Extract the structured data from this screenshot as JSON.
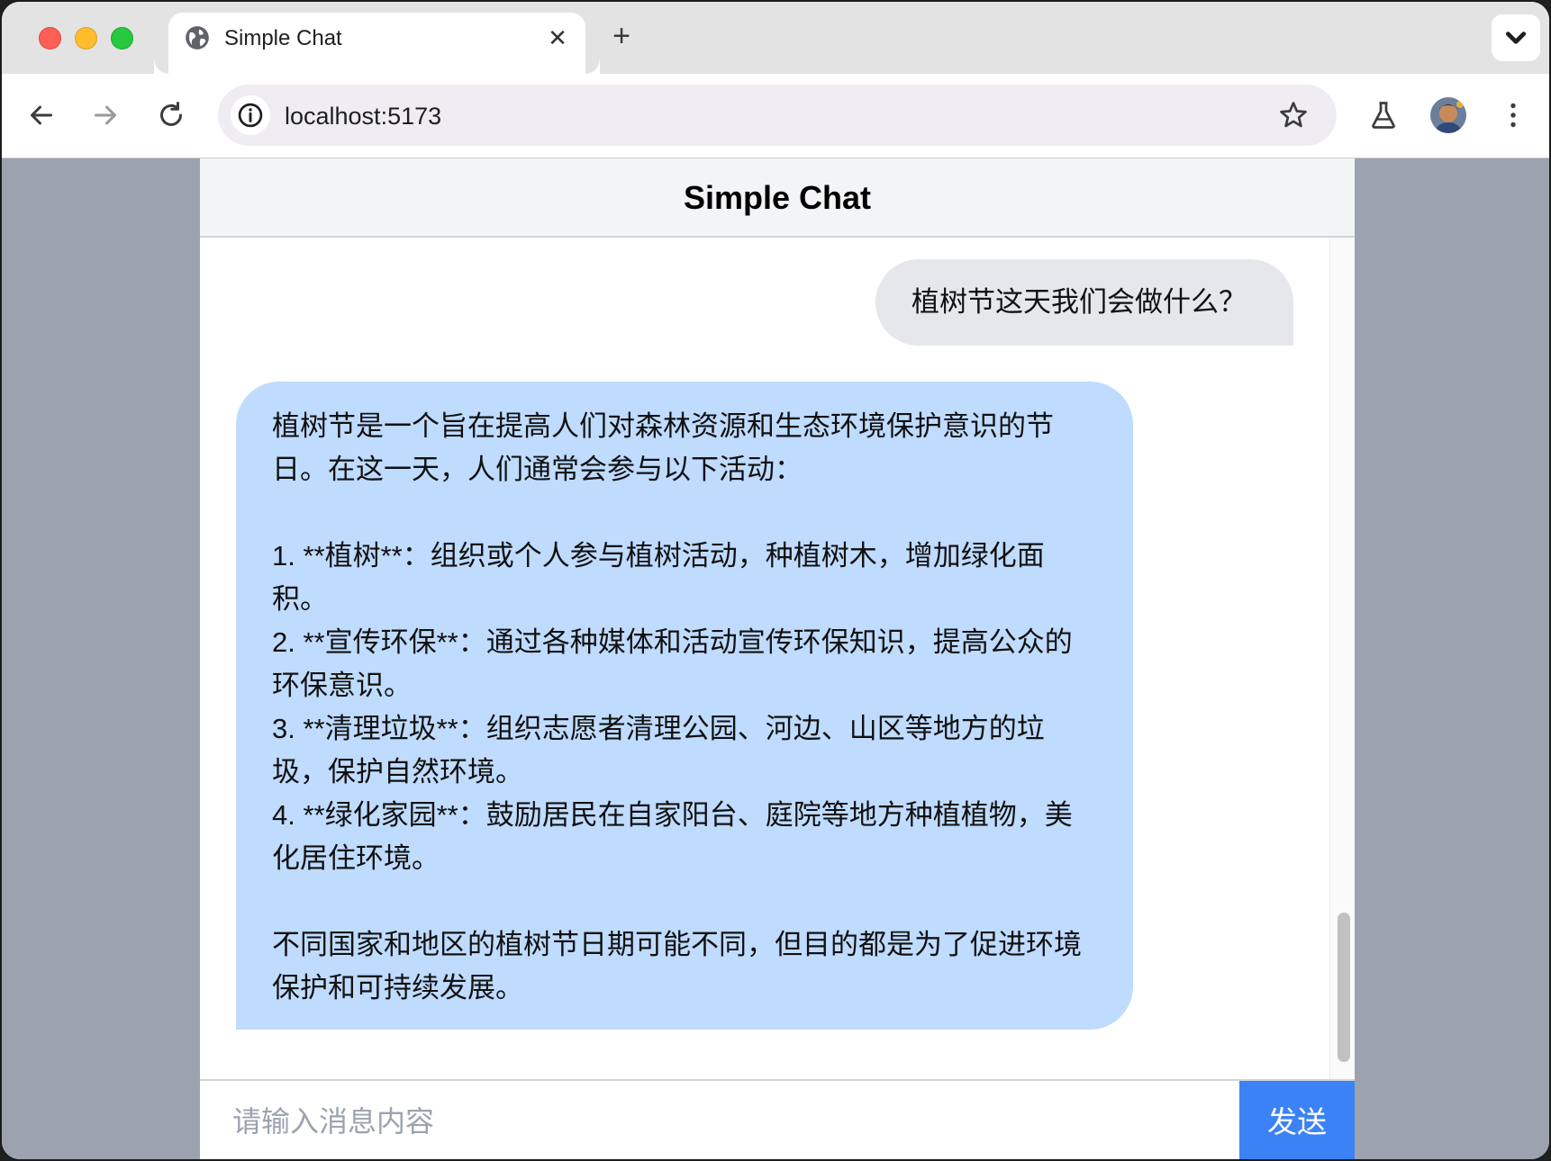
{
  "browser": {
    "tab_title": "Simple Chat",
    "tab_close": "✕",
    "new_tab": "+",
    "url": "localhost:5173"
  },
  "chat": {
    "title": "Simple Chat",
    "messages": [
      {
        "role": "user",
        "text": "植树节这天我们会做什么？"
      },
      {
        "role": "assistant",
        "text": "植树节是一个旨在提高人们对森林资源和生态环境保护意识的节日。在这一天，人们通常会参与以下活动：\n\n1. **植树**：组织或个人参与植树活动，种植树木，增加绿化面积。\n2. **宣传环保**：通过各种媒体和活动宣传环保知识，提高公众的环保意识。\n3. **清理垃圾**：组织志愿者清理公园、河边、山区等地方的垃圾，保护自然环境。\n4. **绿化家园**：鼓励居民在自家阳台、庭院等地方种植植物，美化居住环境。\n\n不同国家和地区的植树节日期可能不同，但目的都是为了促进环境保护和可持续发展。"
      }
    ],
    "input_placeholder": "请输入消息内容",
    "input_value": "",
    "send_label": "发送"
  },
  "colors": {
    "user_bubble": "#e5e7eb",
    "assistant_bubble": "#bfdbfe",
    "send_button": "#3b82f6",
    "page_background": "#9ca3af"
  },
  "icons": [
    "globe-icon",
    "close-icon",
    "plus-icon",
    "chevron-down-icon",
    "back-arrow-icon",
    "forward-arrow-icon",
    "reload-icon",
    "info-icon",
    "star-icon",
    "labs-flask-icon",
    "profile-avatar",
    "more-vert-icon"
  ]
}
